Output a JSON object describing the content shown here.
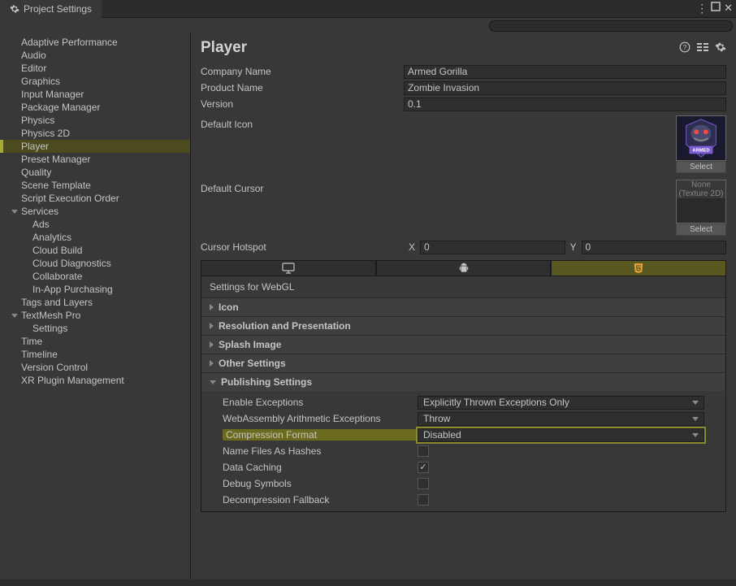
{
  "window": {
    "title": "Project Settings"
  },
  "sidebar": {
    "items": [
      {
        "label": "Adaptive Performance",
        "type": "item"
      },
      {
        "label": "Audio",
        "type": "item"
      },
      {
        "label": "Editor",
        "type": "item"
      },
      {
        "label": "Graphics",
        "type": "item"
      },
      {
        "label": "Input Manager",
        "type": "item"
      },
      {
        "label": "Package Manager",
        "type": "item"
      },
      {
        "label": "Physics",
        "type": "item"
      },
      {
        "label": "Physics 2D",
        "type": "item"
      },
      {
        "label": "Player",
        "type": "item",
        "selected": true
      },
      {
        "label": "Preset Manager",
        "type": "item"
      },
      {
        "label": "Quality",
        "type": "item"
      },
      {
        "label": "Scene Template",
        "type": "item"
      },
      {
        "label": "Script Execution Order",
        "type": "item"
      },
      {
        "label": "Services",
        "type": "group"
      },
      {
        "label": "Ads",
        "type": "child"
      },
      {
        "label": "Analytics",
        "type": "child"
      },
      {
        "label": "Cloud Build",
        "type": "child"
      },
      {
        "label": "Cloud Diagnostics",
        "type": "child"
      },
      {
        "label": "Collaborate",
        "type": "child"
      },
      {
        "label": "In-App Purchasing",
        "type": "child"
      },
      {
        "label": "Tags and Layers",
        "type": "item"
      },
      {
        "label": "TextMesh Pro",
        "type": "group"
      },
      {
        "label": "Settings",
        "type": "child"
      },
      {
        "label": "Time",
        "type": "item"
      },
      {
        "label": "Timeline",
        "type": "item"
      },
      {
        "label": "Version Control",
        "type": "item"
      },
      {
        "label": "XR Plugin Management",
        "type": "item"
      }
    ]
  },
  "header": {
    "title": "Player"
  },
  "company_row": {
    "label": "Company Name",
    "value": "Armed Gorilla"
  },
  "product_row": {
    "label": "Product Name",
    "value": "Zombie Invasion"
  },
  "version_row": {
    "label": "Version",
    "value": "0.1"
  },
  "default_icon": {
    "label": "Default Icon",
    "select": "Select"
  },
  "default_cursor": {
    "label": "Default Cursor",
    "none": "None",
    "tex2d": "(Texture 2D)",
    "select": "Select"
  },
  "hotspot": {
    "label": "Cursor Hotspot",
    "x_label": "X",
    "y_label": "Y",
    "x": "0",
    "y": "0"
  },
  "settings_header": "Settings for WebGL",
  "foldouts": {
    "icon": "Icon",
    "resolution": "Resolution and Presentation",
    "splash": "Splash Image",
    "other": "Other Settings",
    "publishing": "Publishing Settings"
  },
  "publishing": {
    "enable_exceptions": {
      "label": "Enable Exceptions",
      "value": "Explicitly Thrown Exceptions Only"
    },
    "wasm_arith": {
      "label": "WebAssembly Arithmetic Exceptions",
      "value": "Throw"
    },
    "compression": {
      "label": "Compression Format",
      "value": "Disabled"
    },
    "name_hashes": {
      "label": "Name Files As Hashes",
      "checked": false
    },
    "data_caching": {
      "label": "Data Caching",
      "checked": true
    },
    "debug_symbols": {
      "label": "Debug Symbols",
      "checked": false
    },
    "decomp_fallback": {
      "label": "Decompression Fallback",
      "checked": false
    }
  }
}
